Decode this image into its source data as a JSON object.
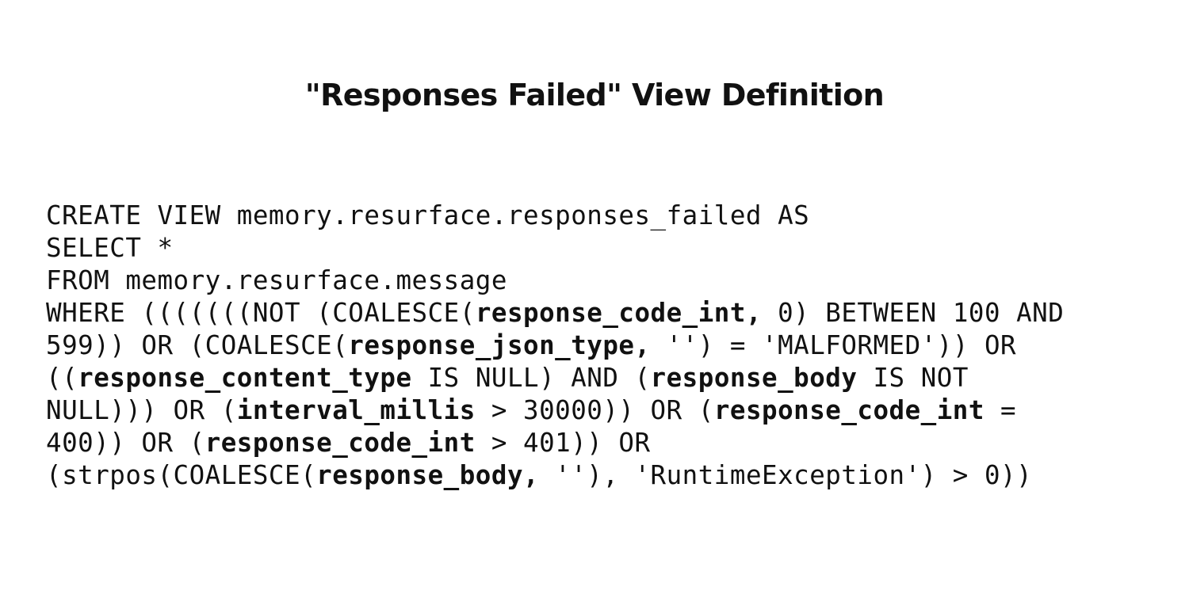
{
  "title": "\"Responses Failed\" View Definition",
  "code": {
    "lines": [
      [
        {
          "text": "CREATE VIEW memory.resurface.responses_failed AS",
          "bold": false
        }
      ],
      [
        {
          "text": "SELECT *",
          "bold": false
        }
      ],
      [
        {
          "text": "FROM memory.resurface.message",
          "bold": false
        }
      ],
      [
        {
          "text": "WHERE (((((((NOT (COALESCE(",
          "bold": false
        },
        {
          "text": "response_code_int,",
          "bold": true
        },
        {
          "text": " 0) BETWEEN 100 AND",
          "bold": false
        }
      ],
      [
        {
          "text": "599)) OR (COALESCE(",
          "bold": false
        },
        {
          "text": "response_json_type,",
          "bold": true
        },
        {
          "text": " '') = 'MALFORMED')) OR",
          "bold": false
        }
      ],
      [
        {
          "text": "((",
          "bold": false
        },
        {
          "text": "response_content_type",
          "bold": true
        },
        {
          "text": " IS NULL) AND (",
          "bold": false
        },
        {
          "text": "response_body",
          "bold": true
        },
        {
          "text": " IS NOT",
          "bold": false
        }
      ],
      [
        {
          "text": "NULL))) OR (",
          "bold": false
        },
        {
          "text": "interval_millis",
          "bold": true
        },
        {
          "text": " > 30000)) OR (",
          "bold": false
        },
        {
          "text": "response_code_int",
          "bold": true
        },
        {
          "text": " =",
          "bold": false
        }
      ],
      [
        {
          "text": "400)) OR (",
          "bold": false
        },
        {
          "text": "response_code_int",
          "bold": true
        },
        {
          "text": " > 401)) OR",
          "bold": false
        }
      ],
      [
        {
          "text": "(strpos(COALESCE(",
          "bold": false
        },
        {
          "text": "response_body,",
          "bold": true
        },
        {
          "text": " ''), 'RuntimeException') > 0))",
          "bold": false
        }
      ]
    ]
  }
}
